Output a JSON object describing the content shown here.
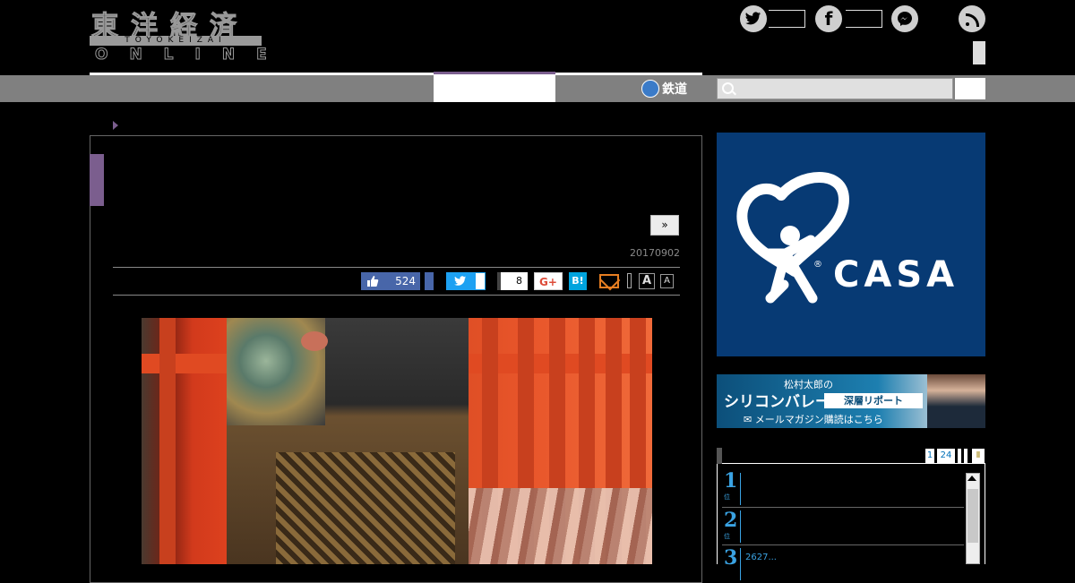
{
  "header": {
    "logo_kanji": "東洋経済",
    "logo_sub": "TOYOKEIZAI",
    "logo_online": "ONLINE"
  },
  "social": {
    "twitter_icon": "twitter-icon",
    "facebook_icon": "facebook-icon",
    "messenger_icon": "messenger-icon",
    "rss_icon": "rss-icon"
  },
  "nav": {
    "rail_label": "鉄道",
    "search_placeholder": ""
  },
  "article": {
    "next_label": "»",
    "date": "20170902",
    "share": {
      "like_count": "524",
      "gplus_count": "8",
      "gplus_label": "G+",
      "hatena_label": "B!",
      "font_large": "A",
      "font_small": "A"
    }
  },
  "ads": {
    "casa_word": "CASA",
    "casa_reg": "®",
    "sv_top": "松村太郎の",
    "sv_main": "シリコンバレー",
    "sv_badge": "深層リポート",
    "sv_bottom": "✉ メールマガジン購読はこちら"
  },
  "ranking": {
    "pages": [
      "1",
      "24"
    ],
    "extra": "Ⅱ",
    "items": [
      {
        "num": "1",
        "unit": "位",
        "text": ""
      },
      {
        "num": "2",
        "unit": "位",
        "text": ""
      },
      {
        "num": "3",
        "unit": "位",
        "text": "2627..."
      }
    ]
  },
  "colors": {
    "accent": "#7b5e8e",
    "nav_gray": "#808080",
    "casa_blue": "#073a74",
    "rank_blue": "#3aa3e3"
  }
}
